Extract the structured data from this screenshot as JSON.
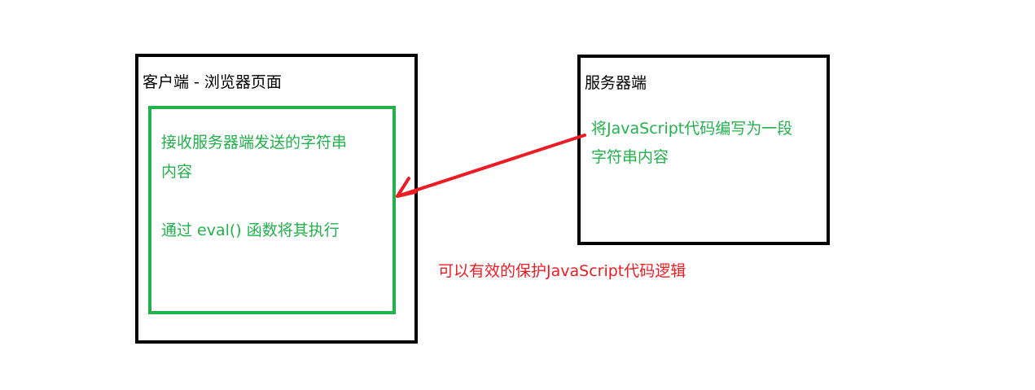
{
  "client": {
    "title": "客户端 - 浏览器页面",
    "lines": [
      "接收服务器端发送的字符串",
      "内容",
      "通过 eval() 函数将其执行"
    ]
  },
  "server": {
    "title": "服务器端",
    "lines": [
      "将JavaScript代码编写为一段",
      "字符串内容"
    ]
  },
  "note": "可以有效的保护JavaScript代码逻辑",
  "colors": {
    "border": "#000000",
    "inner_border": "#22b14c",
    "text_green": "#22b14c",
    "arrow": "#ed1c24",
    "note": "#ed1c24"
  }
}
